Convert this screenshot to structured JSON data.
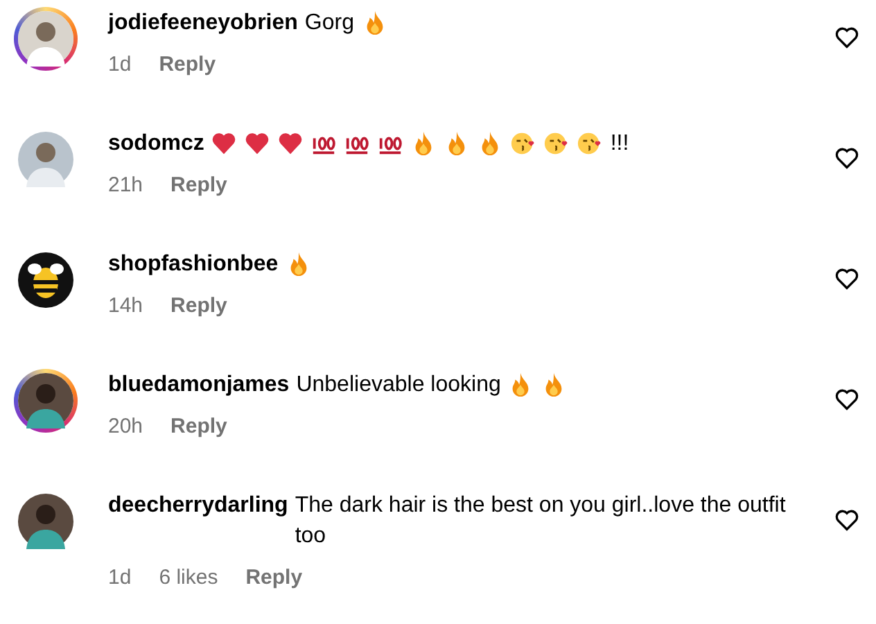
{
  "comments": [
    {
      "user": "jodiefeeneyobrien",
      "has_story": true,
      "avatar": {
        "kind": "figure-light"
      },
      "segments": [
        {
          "kind": "text",
          "text": "Gorg"
        },
        {
          "kind": "fire"
        }
      ],
      "time": "1d",
      "reply": "Reply"
    },
    {
      "user": "sodomcz",
      "has_story": false,
      "avatar": {
        "kind": "figure-grey"
      },
      "segments": [
        {
          "kind": "heart"
        },
        {
          "kind": "heart"
        },
        {
          "kind": "heart"
        },
        {
          "kind": "hundred"
        },
        {
          "kind": "hundred"
        },
        {
          "kind": "hundred"
        },
        {
          "kind": "fire"
        },
        {
          "kind": "fire"
        },
        {
          "kind": "fire"
        },
        {
          "kind": "kiss"
        },
        {
          "kind": "kiss"
        },
        {
          "kind": "kiss"
        },
        {
          "kind": "text",
          "text": "!!!"
        }
      ],
      "time": "21h",
      "reply": "Reply"
    },
    {
      "user": "shopfashionbee",
      "has_story": false,
      "avatar": {
        "kind": "bee"
      },
      "segments": [
        {
          "kind": "fire"
        }
      ],
      "time": "14h",
      "reply": "Reply"
    },
    {
      "user": "bluedamonjames",
      "has_story": true,
      "avatar": {
        "kind": "figure-dark"
      },
      "segments": [
        {
          "kind": "text",
          "text": "Unbelievable looking"
        },
        {
          "kind": "fire"
        },
        {
          "kind": "fire"
        }
      ],
      "time": "20h",
      "reply": "Reply"
    },
    {
      "user": "deecherrydarling",
      "has_story": false,
      "avatar": {
        "kind": "figure-dark"
      },
      "segments": [
        {
          "kind": "text",
          "text": "The dark hair is the best on you girl..love the outfit too"
        }
      ],
      "time": "1d",
      "likes": "6 likes",
      "reply": "Reply"
    }
  ]
}
